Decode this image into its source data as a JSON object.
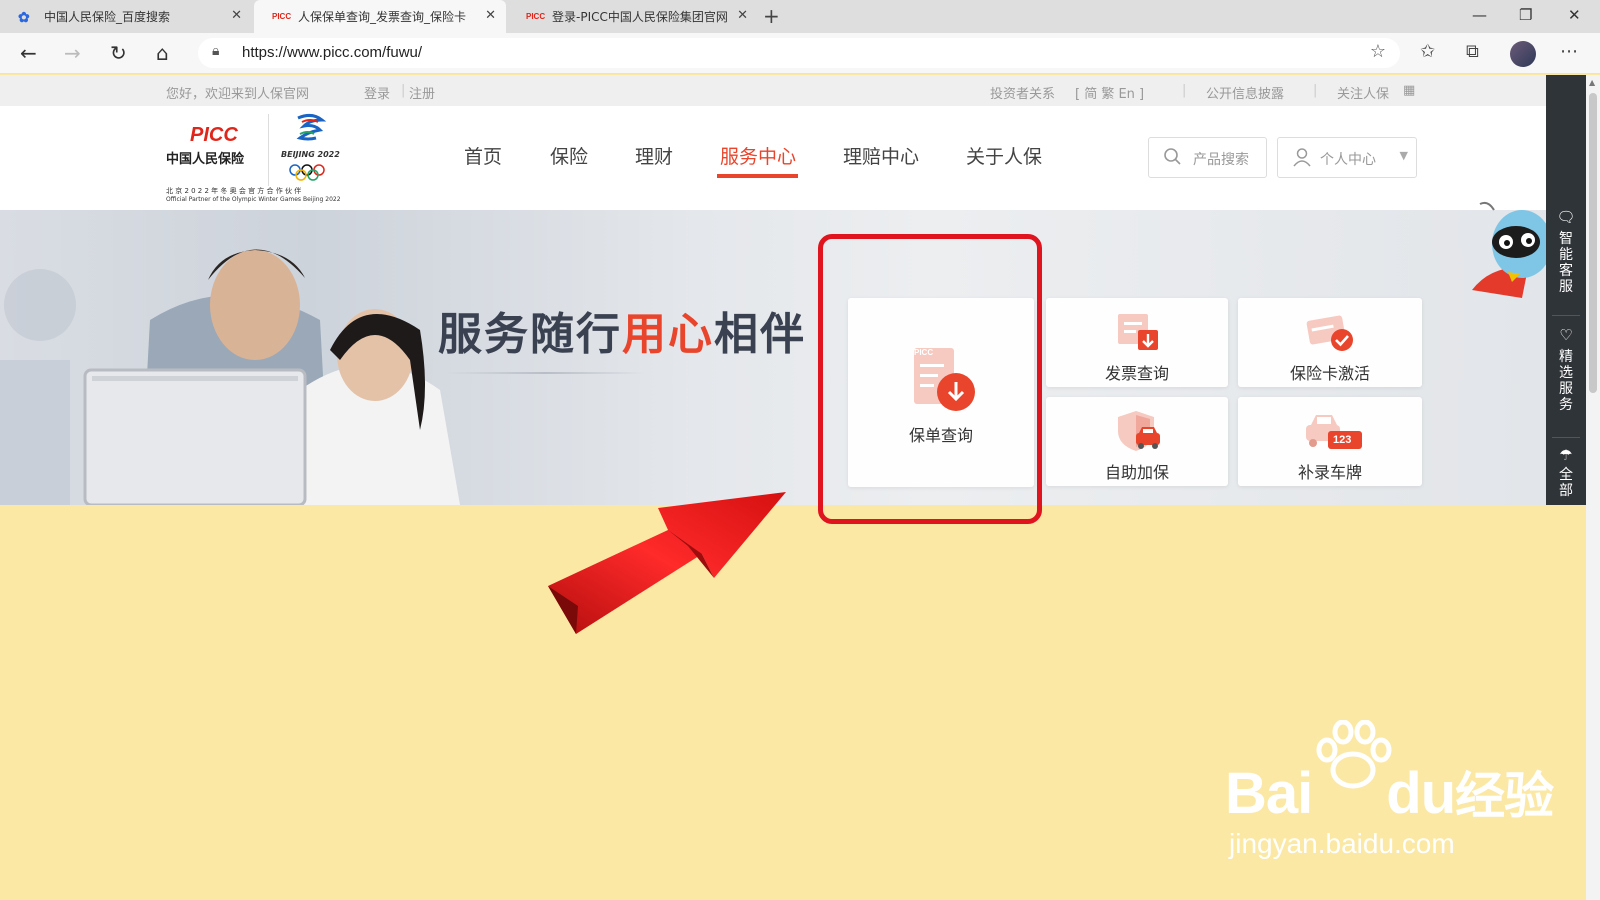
{
  "browser": {
    "tabs": [
      {
        "title": "中国人民保险_百度搜索",
        "favicon": "baidu-paw-icon",
        "close": "✕"
      },
      {
        "title": "人保保单查询_发票查询_保险卡",
        "favicon": "picc-favicon",
        "close": "✕"
      },
      {
        "title": "登录-PICC中国人民保险集团官网",
        "favicon": "picc-favicon",
        "close": "✕"
      }
    ],
    "favicon_text": "PICC",
    "new_tab": "+",
    "url": "https://www.picc.com/fuwu/"
  },
  "topbar": {
    "welcome": "您好，欢迎来到人保官网",
    "login": "登录",
    "divider": "|",
    "register": "注册",
    "investor": "投资者关系",
    "lang": "[ 简  繁  En ]",
    "disclosure": "公开信息披露",
    "follow": "关注人保"
  },
  "logo": {
    "brand": "PICC",
    "name_cn": "中国人民保险",
    "olympic_text": "BEIJING 2022",
    "partner_cn": "北 京 2 0 2 2 年 冬 奥 会 官 方 合 作 伙 伴",
    "partner_en": "Official Partner of the Olympic Winter Games Beijing 2022"
  },
  "nav": {
    "items": [
      "首页",
      "保险",
      "理财",
      "服务中心",
      "理赔中心",
      "关于人保"
    ],
    "active_index": 3
  },
  "search": {
    "label": "产品搜索"
  },
  "user_center": {
    "label": "个人中心"
  },
  "banner": {
    "slogan_part1": "服务随行",
    "slogan_accent": "用心",
    "slogan_part2": "相伴"
  },
  "services": [
    {
      "label": "保单查询",
      "icon": "policy-download-icon"
    },
    {
      "label": "发票查询",
      "icon": "invoice-icon"
    },
    {
      "label": "保险卡激活",
      "icon": "card-activate-icon"
    },
    {
      "label": "自助加保",
      "icon": "shield-car-icon"
    },
    {
      "label": "补录车牌",
      "icon": "car-plate-icon",
      "badge": "123"
    }
  ],
  "sidebar": {
    "items": [
      "智能客服",
      "精选服务",
      "全部"
    ]
  },
  "watermark": {
    "text": "Bai",
    "text2": "du",
    "text_cn": "经验",
    "url": "jingyan.baidu.com"
  },
  "colors": {
    "accent": "#e8452c",
    "highlight": "#e0141e",
    "page_bg": "#fbe8a5"
  }
}
